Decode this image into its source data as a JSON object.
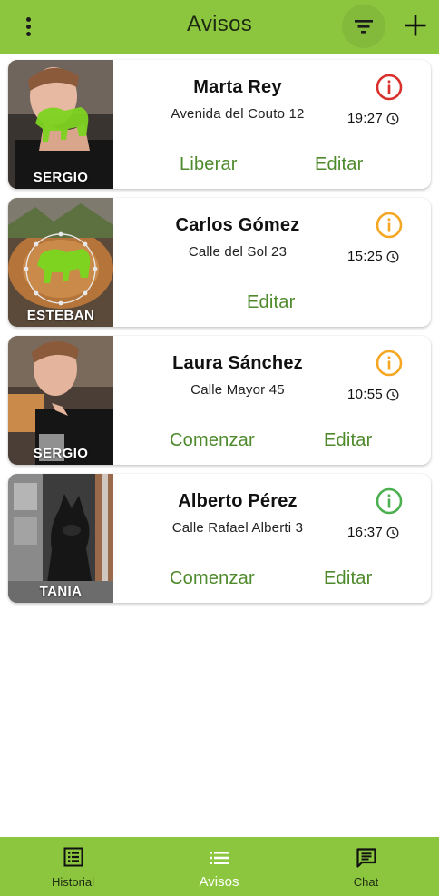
{
  "app": {
    "title": "Avisos"
  },
  "toolbar": {
    "menu_icon": "more-vertical-icon",
    "filter_icon": "filter-icon",
    "add_icon": "plus-icon"
  },
  "colors": {
    "brand": "#8cc63f",
    "action_text": "#4e8a2b",
    "status_red": "#d9302b",
    "status_orange": "#f5a623",
    "status_green": "#4caf50"
  },
  "avisos": [
    {
      "name": "Marta Rey",
      "address": "Avenida del Couto 12",
      "time": "19:27",
      "photo_label": "SERGIO",
      "status": "red",
      "status_icon": "info-icon",
      "actions": [
        "Liberar",
        "Editar"
      ]
    },
    {
      "name": "Carlos Gómez",
      "address": "Calle del Sol 23",
      "time": "15:25",
      "photo_label": "ESTEBAN",
      "status": "orange",
      "status_icon": "info-icon",
      "actions": [
        "Editar"
      ]
    },
    {
      "name": "Laura Sánchez",
      "address": "Calle Mayor 45",
      "time": "10:55",
      "photo_label": "SERGIO",
      "status": "orange",
      "status_icon": "info-icon",
      "actions": [
        "Comenzar",
        "Editar"
      ]
    },
    {
      "name": "Alberto Pérez",
      "address": "Calle Rafael Alberti 3",
      "time": "16:37",
      "photo_label": "TANIA",
      "status": "green",
      "status_icon": "info-icon",
      "actions": [
        "Comenzar",
        "Editar"
      ]
    }
  ],
  "bottom_nav": [
    {
      "label": "Historial",
      "icon": "list-box-icon",
      "active": false
    },
    {
      "label": "Avisos",
      "icon": "list-icon",
      "active": true
    },
    {
      "label": "Chat",
      "icon": "chat-icon",
      "active": false
    }
  ]
}
